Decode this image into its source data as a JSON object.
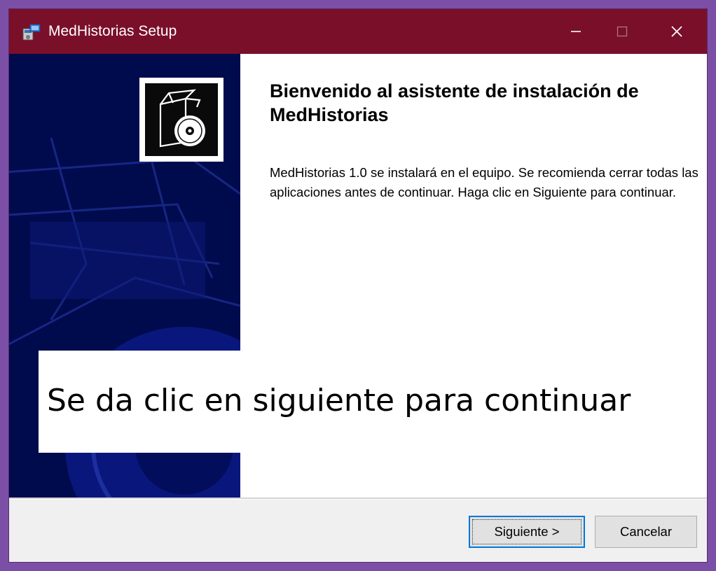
{
  "window": {
    "title": "MedHistorias Setup",
    "colors": {
      "titlebar": "#7a0f2a",
      "sidebar": "#000b4d",
      "accent": "#0078d7"
    }
  },
  "titlebar": {
    "icons": {
      "app": "installer-icon",
      "minimize": "minimize-icon",
      "maximize": "maximize-icon",
      "close": "close-icon"
    }
  },
  "sidebar": {
    "icons": {
      "logo": "box-disc-icon"
    }
  },
  "welcome": {
    "title": "Bienvenido al asistente de instalación de MedHistorias",
    "text": "MedHistorias 1.0 se instalará en el equipo. Se recomienda cerrar todas las aplicaciones antes de continuar. Haga clic en Siguiente para continuar."
  },
  "overlay": {
    "caption": "Se da clic en siguiente para continuar"
  },
  "buttons": {
    "next_label": "Siguiente >",
    "cancel_label": "Cancelar"
  }
}
